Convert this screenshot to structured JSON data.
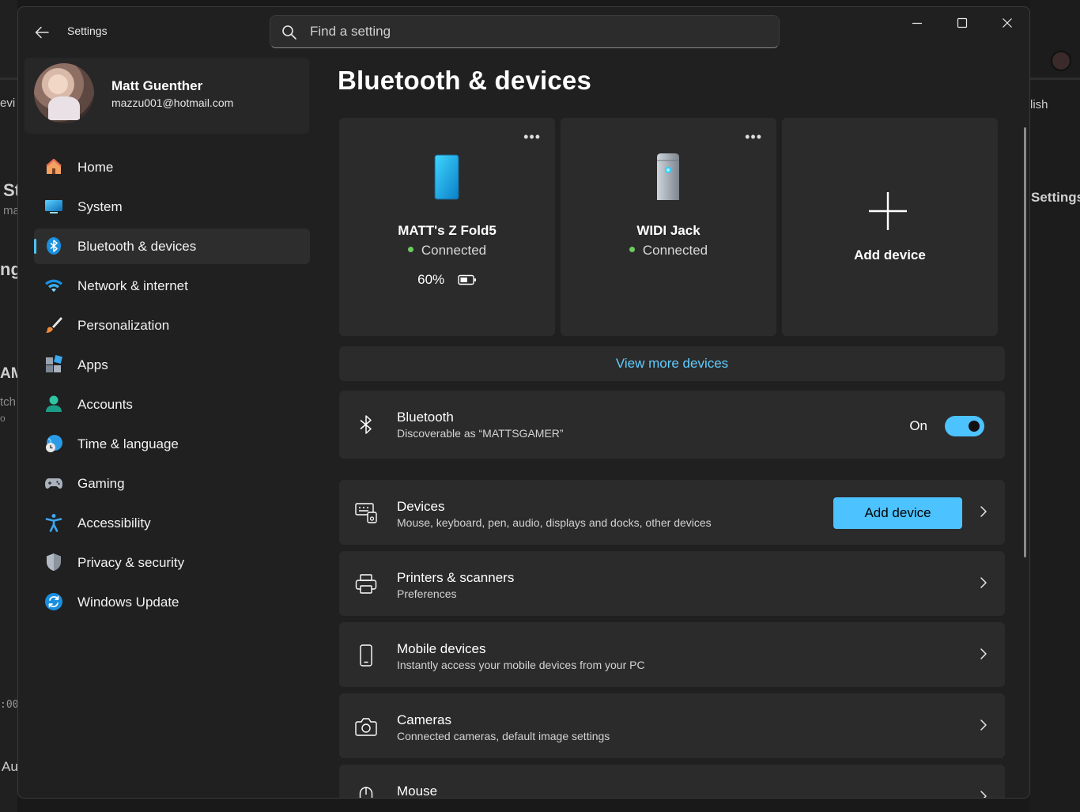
{
  "background": {
    "fragments": [
      "evi",
      "St",
      "ma",
      "ng",
      "AM",
      "tch",
      "o",
      ":00",
      "Au",
      "lish",
      "Settings"
    ]
  },
  "window": {
    "title": "Settings",
    "search_placeholder": "Find a setting"
  },
  "profile": {
    "name": "Matt Guenther",
    "email": "mazzu001@hotmail.com"
  },
  "nav": [
    {
      "label": "Home",
      "icon": "home-icon"
    },
    {
      "label": "System",
      "icon": "system-icon"
    },
    {
      "label": "Bluetooth & devices",
      "icon": "bluetooth-icon",
      "active": true
    },
    {
      "label": "Network & internet",
      "icon": "wifi-icon"
    },
    {
      "label": "Personalization",
      "icon": "brush-icon"
    },
    {
      "label": "Apps",
      "icon": "apps-icon"
    },
    {
      "label": "Accounts",
      "icon": "accounts-icon"
    },
    {
      "label": "Time & language",
      "icon": "globe-clock-icon"
    },
    {
      "label": "Gaming",
      "icon": "gamepad-icon"
    },
    {
      "label": "Accessibility",
      "icon": "accessibility-icon"
    },
    {
      "label": "Privacy & security",
      "icon": "shield-icon"
    },
    {
      "label": "Windows Update",
      "icon": "update-icon"
    }
  ],
  "page_title": "Bluetooth & devices",
  "device_cards": [
    {
      "name": "MATT's Z Fold5",
      "status": "Connected",
      "battery": "60%",
      "battery_level": 0.6,
      "icon": "phone-icon"
    },
    {
      "name": "WIDI Jack",
      "status": "Connected",
      "icon": "speaker-icon"
    },
    {
      "name": "Add device",
      "icon": "plus-icon"
    }
  ],
  "view_more": "View more devices",
  "bluetooth": {
    "title": "Bluetooth",
    "subtitle": "Discoverable as “MATTSGAMER”",
    "state": "On"
  },
  "rows": [
    {
      "title": "Devices",
      "subtitle": "Mouse, keyboard, pen, audio, displays and docks, other devices",
      "button": "Add device",
      "icon": "devices-icon"
    },
    {
      "title": "Printers & scanners",
      "subtitle": "Preferences",
      "icon": "printer-icon"
    },
    {
      "title": "Mobile devices",
      "subtitle": "Instantly access your mobile devices from your PC",
      "icon": "mobile-icon"
    },
    {
      "title": "Cameras",
      "subtitle": "Connected cameras, default image settings",
      "icon": "camera-icon"
    },
    {
      "title": "Mouse",
      "subtitle": "",
      "icon": "mouse-icon"
    }
  ],
  "colors": {
    "accent": "#4cc2ff",
    "link": "#60cdff",
    "connected": "#6ccb5f"
  }
}
